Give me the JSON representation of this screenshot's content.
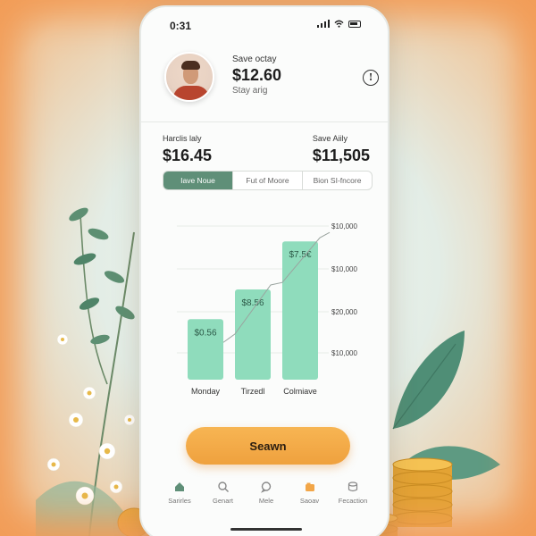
{
  "status_bar": {
    "time": "0:31"
  },
  "profile": {
    "label": "Save octay",
    "amount": "$12.60",
    "sub": "Stay arig",
    "info_icon": "info-icon"
  },
  "summary": {
    "left": {
      "label": "Harclis laly",
      "value": "$16.45"
    },
    "right": {
      "label": "Save Aiily",
      "value": "$11,505"
    }
  },
  "tabs": [
    {
      "label": "Iave Noue",
      "active": true
    },
    {
      "label": "Fut of Moore",
      "active": false
    },
    {
      "label": "Bion SI-fncore",
      "active": false
    }
  ],
  "chart_data": {
    "type": "bar",
    "categories": [
      "Monday",
      "Tirzedl",
      "Colmiave"
    ],
    "values": [
      6.3,
      9.4,
      14.4
    ],
    "value_labels": [
      "$0.56",
      "$8.56",
      "$7.5€"
    ],
    "y_tick_labels": [
      "$10,000",
      "$10,000",
      "$20,000",
      "$10,000"
    ],
    "bar_color": "#8fdcbc",
    "grid": true
  },
  "cta": {
    "label": "Seawn"
  },
  "bottom_nav": [
    {
      "label": "Sarirles",
      "icon": "home-icon",
      "active": true
    },
    {
      "label": "Genart",
      "icon": "search-icon",
      "active": false
    },
    {
      "label": "Mele",
      "icon": "chat-icon",
      "active": false
    },
    {
      "label": "Saoav",
      "icon": "wallet-icon",
      "active": false
    },
    {
      "label": "Fecaction",
      "icon": "stack-icon",
      "active": false
    }
  ],
  "colors": {
    "accent_green": "#5f8f78",
    "accent_orange": "#f2a648",
    "bar_green": "#8fdcbc"
  }
}
